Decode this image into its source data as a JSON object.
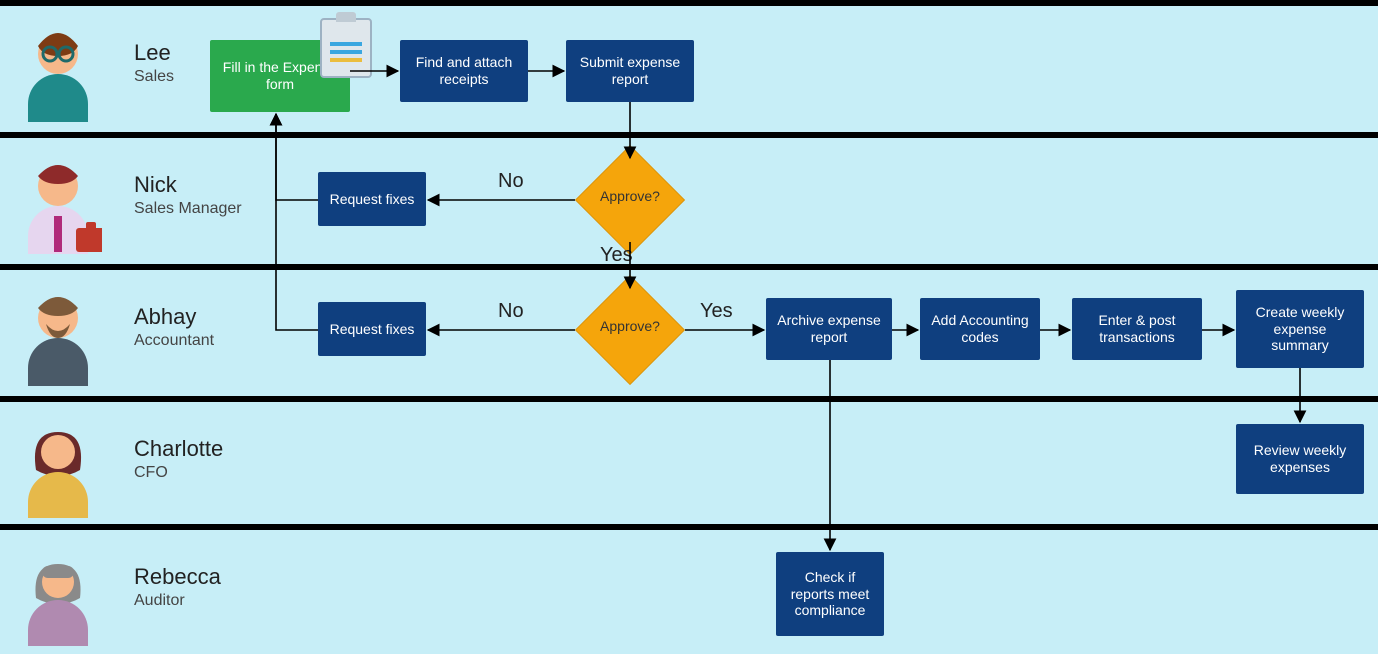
{
  "swimlanes": [
    {
      "id": "lee",
      "name": "Lee",
      "role": "Sales"
    },
    {
      "id": "nick",
      "name": "Nick",
      "role": "Sales Manager"
    },
    {
      "id": "abhay",
      "name": "Abhay",
      "role": "Accountant"
    },
    {
      "id": "charlotte",
      "name": "Charlotte",
      "role": "CFO"
    },
    {
      "id": "rebecca",
      "name": "Rebecca",
      "role": "Auditor"
    }
  ],
  "nodes": {
    "fill_form": {
      "label": "Fill in the Expense form"
    },
    "attach_receipts": {
      "label": "Find and attach receipts"
    },
    "submit_report": {
      "label": "Submit expense report"
    },
    "d_mgr": {
      "label": "Approve?"
    },
    "req_fixes_mgr": {
      "label": "Request fixes"
    },
    "d_acct": {
      "label": "Approve?"
    },
    "req_fixes_acct": {
      "label": "Request fixes"
    },
    "archive": {
      "label": "Archive expense report"
    },
    "acct_codes": {
      "label": "Add Accounting codes"
    },
    "post_txn": {
      "label": "Enter & post transactions"
    },
    "weekly_summary": {
      "label": "Create weekly expense summary"
    },
    "review_weekly": {
      "label": "Review weekly expenses"
    },
    "compliance": {
      "label": "Check if reports meet compliance"
    }
  },
  "edge_labels": {
    "mgr_no": "No",
    "mgr_yes": "Yes",
    "acct_no": "No",
    "acct_yes": "Yes"
  },
  "colors": {
    "lane_bg": "#c7eef7",
    "box_blue": "#0f3f7f",
    "box_green": "#2aa94d",
    "diamond": "#f5a50b"
  }
}
